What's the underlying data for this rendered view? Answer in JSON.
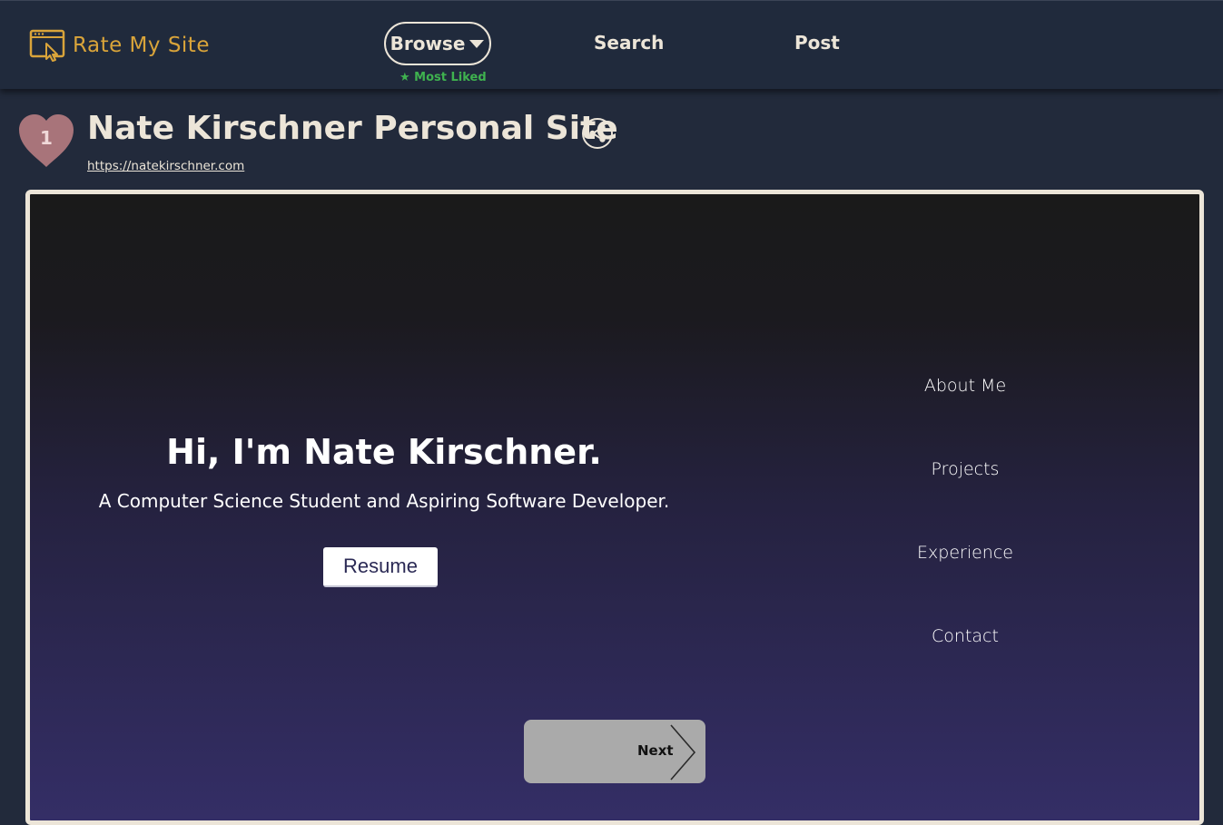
{
  "header": {
    "logo_text": "Rate My Site",
    "nav": {
      "browse_label": "Browse",
      "browse_sub_label": "★ Most Liked",
      "search_label": "Search",
      "post_label": "Post"
    }
  },
  "site": {
    "like_count": "1",
    "title": "Nate Kirschner Personal Site",
    "url": "https://natekirschner.com"
  },
  "preview": {
    "hero_title": "Hi, I'm Nate Kirschner.",
    "hero_subtitle": "A Computer Science Student and Aspiring Software Developer.",
    "resume_label": "Resume",
    "nav_items": [
      "About Me",
      "Projects",
      "Experience",
      "Contact"
    ],
    "next_label": "Next"
  },
  "colors": {
    "accent_gold": "#d9a43a",
    "heart_pink": "#a8747a",
    "sub_label_green": "#3fb24f",
    "header_bg": "#202a3c"
  }
}
